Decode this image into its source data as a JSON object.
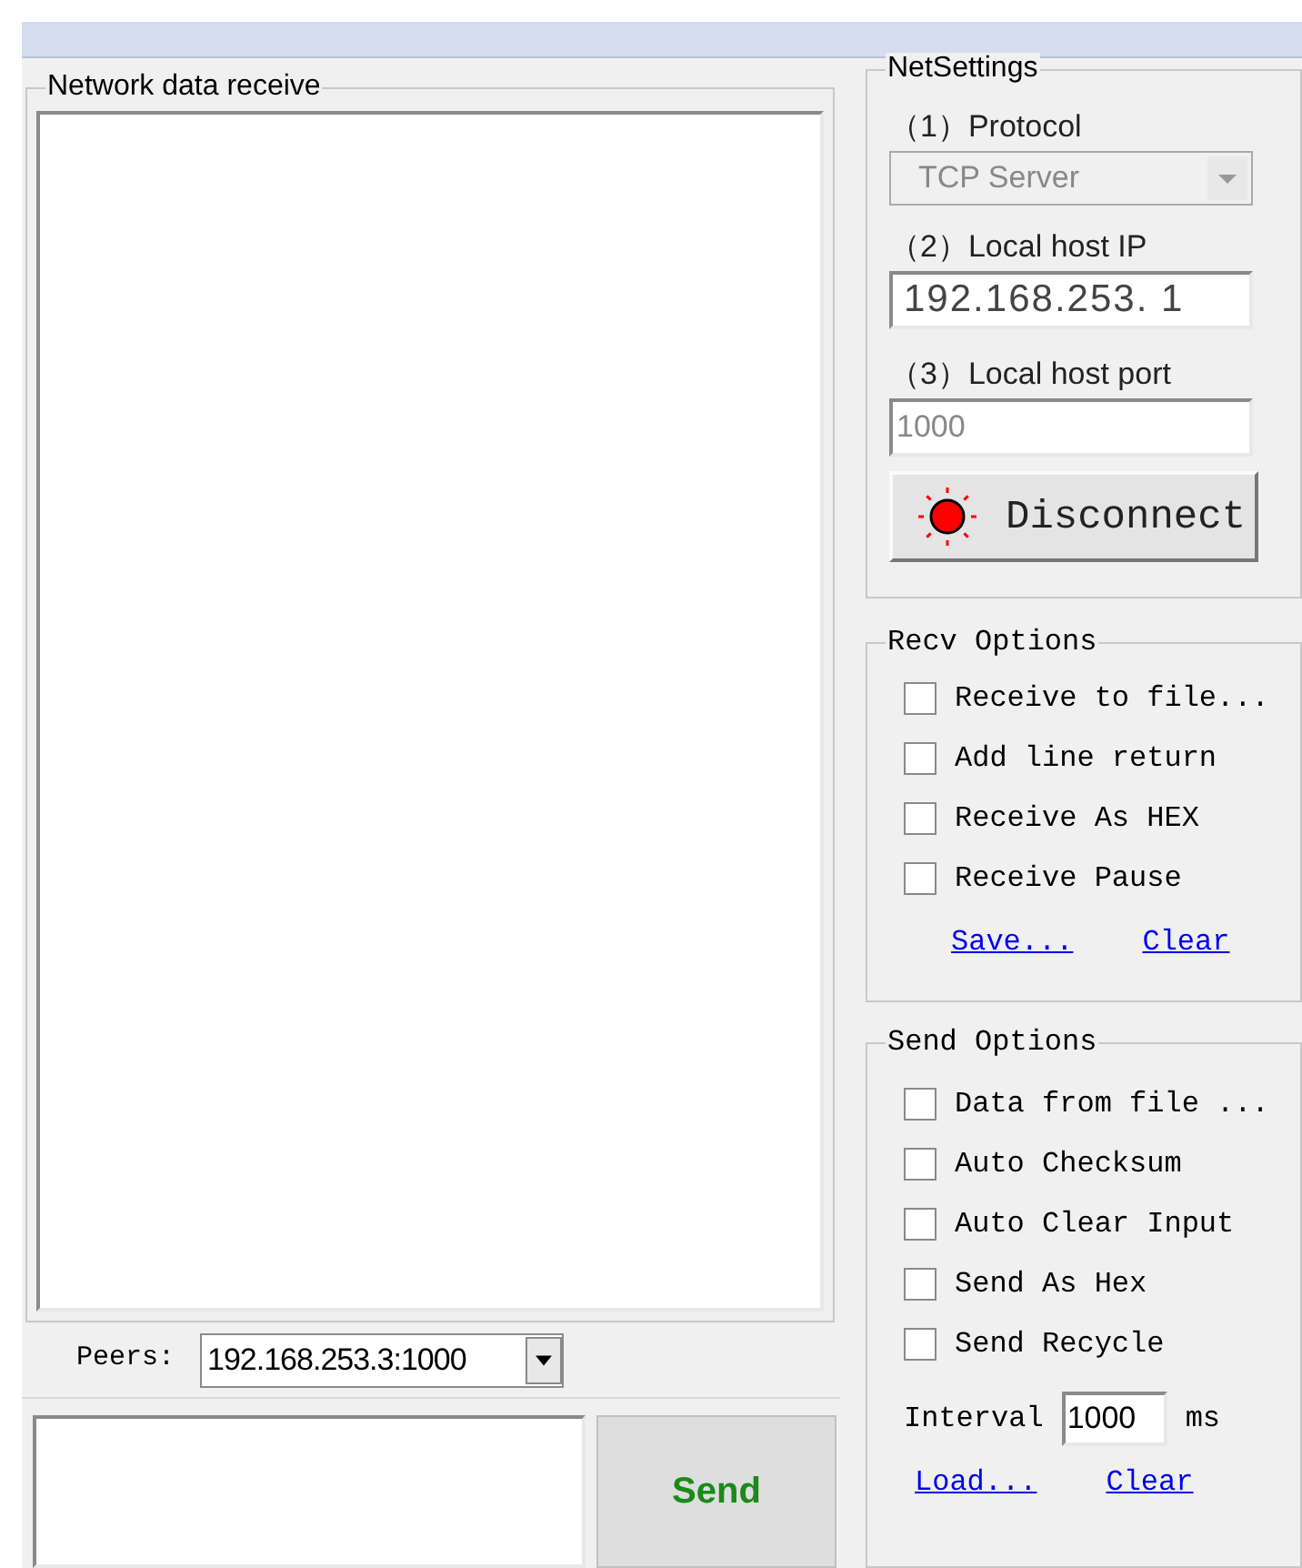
{
  "receive": {
    "title": "Network data receive"
  },
  "peers": {
    "label": "Peers:",
    "value": "192.168.253.3:1000"
  },
  "send_button": "Send",
  "net_settings": {
    "title": "NetSettings",
    "protocol": {
      "label": "（1）Protocol",
      "value": "TCP Server",
      "disabled": true
    },
    "host_ip": {
      "label": "（2）Local host IP",
      "octets": [
        "192",
        "168",
        "253",
        " 1"
      ],
      "separator": "."
    },
    "host_port": {
      "label": "（3）Local host port",
      "value": "1000",
      "disabled": true
    },
    "connect_button": {
      "label": "Disconnect",
      "connected": true
    }
  },
  "recv_options": {
    "title": "Recv Options",
    "items": [
      {
        "label": "Receive to file...",
        "checked": false
      },
      {
        "label": "Add line return",
        "checked": false
      },
      {
        "label": "Receive As HEX",
        "checked": false
      },
      {
        "label": "Receive Pause",
        "checked": false
      }
    ],
    "links": [
      "Save...",
      "Clear"
    ]
  },
  "send_options": {
    "title": "Send Options",
    "items": [
      {
        "label": "Data from file ...",
        "checked": false
      },
      {
        "label": "Auto Checksum",
        "checked": false
      },
      {
        "label": "Auto Clear Input",
        "checked": false
      },
      {
        "label": "Send As Hex",
        "checked": false
      },
      {
        "label": "Send Recycle",
        "checked": false
      }
    ],
    "interval": {
      "label": "Interval",
      "value": "1000",
      "unit": "ms"
    },
    "links": [
      "Load...",
      "Clear"
    ]
  }
}
